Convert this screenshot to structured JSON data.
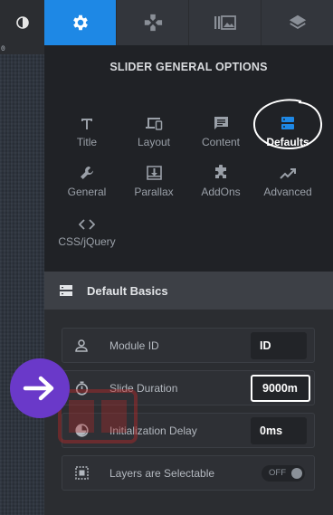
{
  "left_strip": {
    "icon": "contrast-icon",
    "ruler_label": "0"
  },
  "top_tabs": [
    {
      "icon": "gear-icon",
      "active": true
    },
    {
      "icon": "gamepad-icon",
      "active": false
    },
    {
      "icon": "media-icon",
      "active": false
    },
    {
      "icon": "layers-icon",
      "active": false
    }
  ],
  "panel": {
    "title": "SLIDER GENERAL OPTIONS",
    "items": [
      {
        "label": "Title",
        "icon": "text-icon"
      },
      {
        "label": "Layout",
        "icon": "devices-icon"
      },
      {
        "label": "Content",
        "icon": "message-icon"
      },
      {
        "label": "Defaults",
        "icon": "server-icon",
        "active": true
      },
      {
        "label": "General",
        "icon": "wrench-icon"
      },
      {
        "label": "Parallax",
        "icon": "download-box-icon"
      },
      {
        "label": "AddOns",
        "icon": "puzzle-icon"
      },
      {
        "label": "Advanced",
        "icon": "trend-icon"
      },
      {
        "label": "CSS/jQuery",
        "icon": "code-icon"
      }
    ]
  },
  "section": {
    "title": "Default Basics",
    "icon": "list-icon"
  },
  "fields": [
    {
      "label": "Module ID",
      "value": "ID",
      "icon": "user-icon"
    },
    {
      "label": "Slide Duration",
      "value": "9000m",
      "icon": "stopwatch-icon",
      "highlight": true
    },
    {
      "label": "Initialization Delay",
      "value": "0ms",
      "icon": "timer-icon"
    },
    {
      "label": "Layers are Selectable",
      "toggle": "OFF",
      "icon": "select-icon"
    }
  ],
  "colors": {
    "accent": "#1e88e5",
    "badge": "#6a39c9",
    "background": "#2b2d31"
  }
}
